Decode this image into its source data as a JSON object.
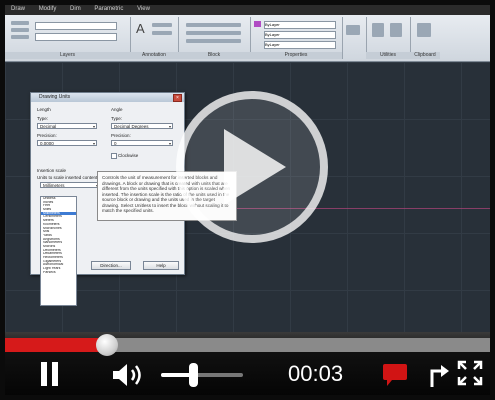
{
  "menubar": {
    "items": [
      "Draw",
      "Modify",
      "Dim",
      "Parametric",
      "View"
    ]
  },
  "ribbon": {
    "panels": [
      "Layers",
      "Annotation",
      "Block",
      "Properties",
      "Utilities",
      "Clipboard"
    ],
    "property_values": [
      "ByLayer",
      "ByLayer",
      "ByLayer"
    ]
  },
  "dialog": {
    "title": "Drawing Units",
    "length_label": "Length",
    "length_type_label": "Type:",
    "length_type_value": "Decimal",
    "length_precision_label": "Precision:",
    "length_precision_value": "0.0000",
    "angle_label": "Angle",
    "angle_type_label": "Type:",
    "angle_type_value": "Decimal Degrees",
    "angle_precision_label": "Precision:",
    "angle_precision_value": "0",
    "clockwise_label": "Clockwise",
    "insertion_label": "Insertion scale",
    "insertion_sublabel": "Units to scale inserted content:",
    "insertion_value": "Millimeters",
    "unit_list": [
      "Unitless",
      "Inches",
      "Feet",
      "Miles",
      "Millimeters",
      "Centimeters",
      "Meters",
      "Kilometers",
      "Microinches",
      "Mils",
      "Yards",
      "Angstroms",
      "Nanometers",
      "Microns",
      "Decimeters",
      "Dekameters",
      "Hectometers",
      "Gigameters",
      "Astronomical",
      "Light Years",
      "Parsecs"
    ],
    "selected_unit": "Millimeters",
    "ok_label": "Direction...",
    "help_label": "Help"
  },
  "tooltip": {
    "text": "Controls the unit of measurement for inserted blocks and drawings. A block or drawing that is created with units that are different from the units specified with this option is scaled when inserted. The insertion scale is the ratio of the units used in the source block or drawing and the units used in the target drawing. Select Unitless to insert the block without scaling it to match the specified units."
  },
  "player": {
    "time": "00:03",
    "progress_percent": 21,
    "volume_percent": 39,
    "colors": {
      "accent": "#d61a1a",
      "control": "#ffffff"
    },
    "icons": [
      "play-icon",
      "pause-icon",
      "volume-icon",
      "comment-icon",
      "share-icon",
      "fullscreen-icon"
    ]
  }
}
